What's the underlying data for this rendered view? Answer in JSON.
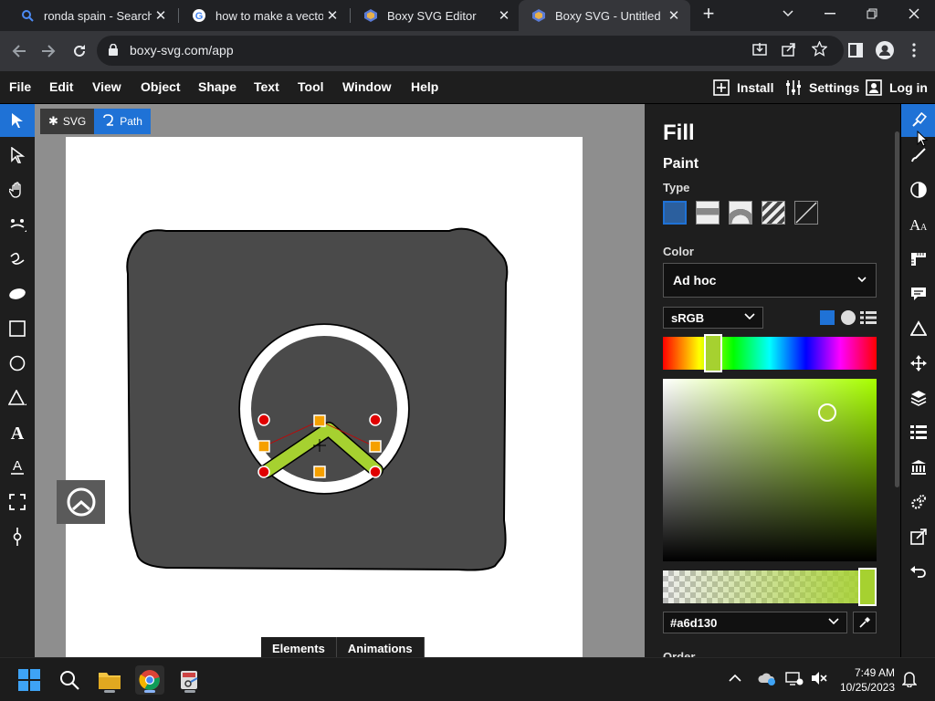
{
  "browser": {
    "tabs": [
      {
        "title": "ronda spain - Search",
        "favicon": "search-icon",
        "active": false
      },
      {
        "title": "how to make a vector i",
        "favicon": "google-icon",
        "active": false
      },
      {
        "title": "Boxy SVG Editor",
        "favicon": "boxy-icon",
        "active": false
      },
      {
        "title": "Boxy SVG - Untitled [Ec",
        "favicon": "boxy-icon",
        "active": true
      }
    ],
    "new_tab": "+",
    "url": "boxy-svg.com/app"
  },
  "menubar": {
    "items": [
      "File",
      "Edit",
      "View",
      "Object",
      "Shape",
      "Text",
      "Tool",
      "Window",
      "Help"
    ],
    "install": "Install",
    "settings": "Settings",
    "login": "Log in"
  },
  "canvas": {
    "context": {
      "svg": "SVG",
      "path": "Path"
    },
    "bottom_tabs": [
      "Elements",
      "Animations"
    ],
    "shape_fill": "#4a4a4a",
    "stroke_color": "#a6d130"
  },
  "panel": {
    "title": "Fill",
    "section": "Paint",
    "type_label": "Type",
    "color_label": "Color",
    "color_mode": "Ad hoc",
    "color_space": "sRGB",
    "hex": "#a6d130",
    "order_label": "Order"
  },
  "taskbar": {
    "time": "7:49 AM",
    "date": "10/25/2023"
  },
  "colors": {
    "accent": "#1f72d6",
    "current_fill": "#a6d130"
  }
}
